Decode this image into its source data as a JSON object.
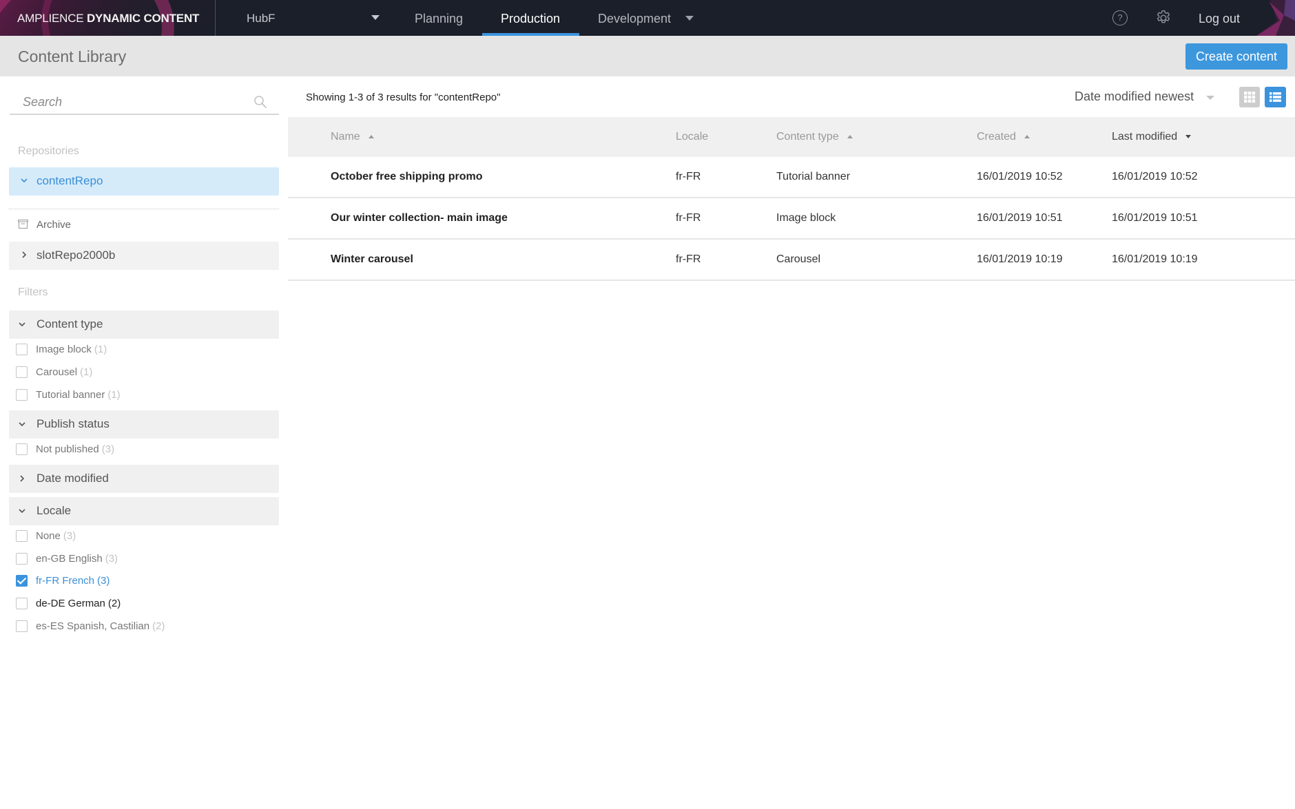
{
  "topbar": {
    "brand_light": "AMPLIENCE",
    "brand_bold": "DYNAMIC CONTENT",
    "hub": "HubF",
    "nav": [
      {
        "label": "Planning",
        "active": false
      },
      {
        "label": "Production",
        "active": true
      },
      {
        "label": "Development",
        "active": false
      }
    ],
    "help_glyph": "?",
    "logout": "Log out",
    "accent": "#3b93dd"
  },
  "subheader": {
    "title": "Content Library",
    "create_button": "Create content"
  },
  "sidebar": {
    "search_placeholder": "Search",
    "repositories_label": "Repositories",
    "repositories": [
      {
        "name": "contentRepo",
        "expanded": true,
        "selected": true
      },
      {
        "name": "slotRepo2000b",
        "expanded": false,
        "selected": false
      }
    ],
    "archive_label": "Archive",
    "filters_label": "Filters",
    "filter_groups": [
      {
        "title": "Content type",
        "expanded": true,
        "options": [
          {
            "label": "Image block",
            "count": "(1)",
            "checked": false
          },
          {
            "label": "Carousel",
            "count": "(1)",
            "checked": false
          },
          {
            "label": "Tutorial banner",
            "count": "(1)",
            "checked": false
          }
        ]
      },
      {
        "title": "Publish status",
        "expanded": true,
        "options": [
          {
            "label": "Not published",
            "count": "(3)",
            "checked": false
          }
        ]
      },
      {
        "title": "Date modified",
        "expanded": false,
        "options": []
      },
      {
        "title": "Locale",
        "expanded": true,
        "options": [
          {
            "label": "None",
            "count": "(3)",
            "checked": false
          },
          {
            "label": "en-GB English",
            "count": "(3)",
            "checked": false
          },
          {
            "label": "fr-FR French",
            "count": "(3)",
            "checked": true
          },
          {
            "label": "de-DE German",
            "count": "(2)",
            "checked": false
          },
          {
            "label": "es-ES Spanish, Castilian",
            "count": "(2)",
            "checked": false
          }
        ]
      }
    ]
  },
  "main": {
    "results_text": "Showing 1-3 of 3 results for \"contentRepo\"",
    "sort_label": "Date modified newest",
    "view_mode": "list",
    "columns": [
      {
        "label": "Name",
        "sort": "asc",
        "active": false
      },
      {
        "label": "Locale",
        "sort": null,
        "active": false
      },
      {
        "label": "Content type",
        "sort": "asc",
        "active": false
      },
      {
        "label": "Created",
        "sort": "asc",
        "active": false
      },
      {
        "label": "Last modified",
        "sort": "desc",
        "active": true
      }
    ],
    "rows": [
      {
        "name": "October free shipping promo",
        "locale": "fr-FR",
        "content_type": "Tutorial banner",
        "created": "16/01/2019 10:52",
        "last_modified": "16/01/2019 10:52"
      },
      {
        "name": "Our winter collection- main image",
        "locale": "fr-FR",
        "content_type": "Image block",
        "created": "16/01/2019 10:51",
        "last_modified": "16/01/2019 10:51"
      },
      {
        "name": "Winter carousel",
        "locale": "fr-FR",
        "content_type": "Carousel",
        "created": "16/01/2019 10:19",
        "last_modified": "16/01/2019 10:19"
      }
    ]
  }
}
